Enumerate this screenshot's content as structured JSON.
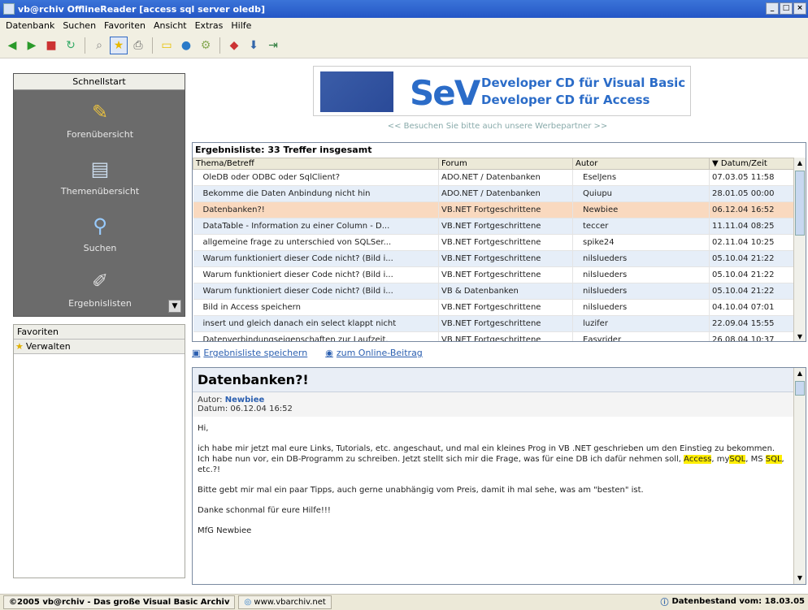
{
  "window": {
    "title": "vb@rchiv OfflineReader [access sql server oledb]"
  },
  "menu": [
    "Datenbank",
    "Suchen",
    "Favoriten",
    "Ansicht",
    "Extras",
    "Hilfe"
  ],
  "toolbar": {
    "icons": [
      "back-icon",
      "forward-icon",
      "stop-icon",
      "refresh-icon",
      "find-icon",
      "favorites-icon",
      "print-icon",
      "note-icon",
      "globe-icon",
      "tool-icon",
      "book-icon",
      "download-icon",
      "exit-icon"
    ]
  },
  "quickstart": {
    "header": "Schnellstart",
    "items": [
      {
        "label": "Forenübersicht",
        "icon": "forum-icon"
      },
      {
        "label": "Themenübersicht",
        "icon": "topics-icon"
      },
      {
        "label": "Suchen",
        "icon": "magnifier-icon"
      },
      {
        "label": "Ergebnislisten",
        "icon": "results-icon"
      }
    ]
  },
  "favorites": {
    "header": "Favoriten",
    "item": "Verwalten"
  },
  "banner": {
    "line1": "Developer CD für Visual Basic",
    "line2": "Developer CD für Access",
    "brand": "SeV",
    "note": "<< Besuchen Sie bitte auch unsere Werbepartner >>"
  },
  "results": {
    "title": "Ergebnisliste: 33 Treffer insgesamt",
    "columns": [
      "Thema/Betreff",
      "Forum",
      "Autor",
      "▼ Datum/Zeit"
    ],
    "rows": [
      [
        "OleDB oder ODBC oder SqlClient?",
        "ADO.NET / Datenbanken",
        "EselJens",
        "07.03.05 11:58"
      ],
      [
        "Bekomme die Daten Anbindung nicht hin",
        "ADO.NET / Datenbanken",
        "Quiupu",
        "28.01.05 00:00"
      ],
      [
        "Datenbanken?!",
        "VB.NET Fortgeschrittene",
        "Newbiee",
        "06.12.04 16:52"
      ],
      [
        "DataTable - Information zu einer Column - D...",
        "VB.NET Fortgeschrittene",
        "teccer",
        "11.11.04 08:25"
      ],
      [
        "allgemeine frage zu unterschied von SQLSer...",
        "VB.NET Fortgeschrittene",
        "spike24",
        "02.11.04 10:25"
      ],
      [
        "Warum funktioniert dieser Code nicht? (Bild i...",
        "VB.NET Fortgeschrittene",
        "nilslueders",
        "05.10.04 21:22"
      ],
      [
        "Warum funktioniert dieser Code nicht? (Bild i...",
        "VB.NET Fortgeschrittene",
        "nilslueders",
        "05.10.04 21:22"
      ],
      [
        "Warum funktioniert dieser Code nicht? (Bild i...",
        "VB & Datenbanken",
        "nilslueders",
        "05.10.04 21:22"
      ],
      [
        "Bild in Access speichern",
        "VB.NET Fortgeschrittene",
        "nilslueders",
        "04.10.04 07:01"
      ],
      [
        "insert und gleich danach ein select klappt nicht",
        "VB.NET Fortgeschrittene",
        "luzifer",
        "22.09.04 15:55"
      ],
      [
        "Datenverbindungseigenschaften zur Laufzeit.",
        "VB.NET Fortgeschrittene",
        "Easyrider",
        "26.08.04 10:37"
      ]
    ],
    "selected_index": 2
  },
  "links": {
    "save": "Ergebnisliste speichern",
    "online": "zum Online-Beitrag"
  },
  "detail": {
    "title": "Datenbanken?!",
    "author_label": "Autor:",
    "author": "Newbiee",
    "date": "Datum: 06.12.04 16:52",
    "greeting": "Hi,",
    "p1_a": "ich habe mir jetzt mal eure Links, Tutorials, etc. angeschaut, und mal ein kleines Prog in VB .NET geschrieben um den Einstieg zu bekommen. Ich habe nun vor, ein DB-Programm zu schreiben. Jetzt stellt sich mir die Frage, was für eine DB ich dafür nehmen soll, ",
    "hl1": "Access",
    "p1_b": ", my",
    "hl2": "SQL",
    "p1_c": ", MS ",
    "hl3": "SQL",
    "p1_d": ", etc.?!",
    "p2": "Bitte gebt mir mal ein paar Tipps, auch gerne unabhängig vom Preis, damit ih mal sehe, was am \"besten\" ist.",
    "p3": "Danke schonmal für eure Hilfe!!!",
    "p4": "MfG Newbiee"
  },
  "status": {
    "left": "©2005 vb@rchiv - Das große Visual Basic Archiv",
    "url": "www.vbarchiv.net",
    "right": "Datenbestand vom: 18.03.05"
  }
}
